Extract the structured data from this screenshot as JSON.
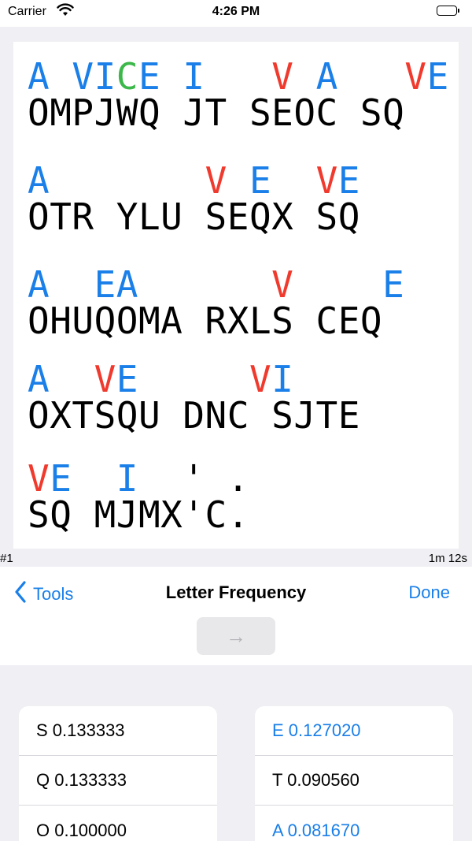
{
  "status_bar": {
    "carrier": "Carrier",
    "time": "4:26 PM"
  },
  "puzzle": {
    "lines": [
      {
        "hint": [
          {
            "text": "A",
            "color": "blue"
          },
          {
            "text": " ",
            "color": "blue"
          },
          {
            "text": "VI",
            "color": "blue"
          },
          {
            "text": "C",
            "color": "green"
          },
          {
            "text": "E",
            "color": "blue"
          },
          {
            "text": " ",
            "color": "blue"
          },
          {
            "text": "I",
            "color": "blue"
          },
          {
            "text": "   ",
            "color": "blue"
          },
          {
            "text": "V",
            "color": "red"
          },
          {
            "text": " ",
            "color": "blue"
          },
          {
            "text": "A",
            "color": "blue"
          },
          {
            "text": "   ",
            "color": "blue"
          },
          {
            "text": "V",
            "color": "red"
          },
          {
            "text": "E",
            "color": "blue"
          }
        ],
        "cipher": "OMPJWQ JT SEOC SQ"
      },
      {
        "hint": [
          {
            "text": "A",
            "color": "blue"
          },
          {
            "text": "       ",
            "color": "blue"
          },
          {
            "text": "V",
            "color": "red"
          },
          {
            "text": " ",
            "color": "blue"
          },
          {
            "text": "E",
            "color": "blue"
          },
          {
            "text": "  ",
            "color": "blue"
          },
          {
            "text": "V",
            "color": "red"
          },
          {
            "text": "E",
            "color": "blue"
          }
        ],
        "cipher": "OTR YLU SEQX SQ"
      },
      {
        "hint": [
          {
            "text": "A",
            "color": "blue"
          },
          {
            "text": "  ",
            "color": "blue"
          },
          {
            "text": "EA",
            "color": "blue"
          },
          {
            "text": "      ",
            "color": "blue"
          },
          {
            "text": "V",
            "color": "red"
          },
          {
            "text": "    ",
            "color": "blue"
          },
          {
            "text": "E",
            "color": "blue"
          }
        ],
        "cipher": "OHUQOMA RXLS CEQ"
      },
      {
        "hint": [
          {
            "text": "A",
            "color": "blue"
          },
          {
            "text": "  ",
            "color": "blue"
          },
          {
            "text": "V",
            "color": "red"
          },
          {
            "text": "E",
            "color": "blue"
          },
          {
            "text": "     ",
            "color": "blue"
          },
          {
            "text": "V",
            "color": "red"
          },
          {
            "text": "I",
            "color": "blue"
          }
        ],
        "cipher": "OXTSQU DNC SJTE"
      },
      {
        "hint": [
          {
            "text": "V",
            "color": "red"
          },
          {
            "text": "E",
            "color": "blue"
          },
          {
            "text": "  ",
            "color": "blue"
          },
          {
            "text": "I",
            "color": "blue"
          },
          {
            "text": "  ",
            "color": "blue"
          },
          {
            "text": "'",
            "color": "black"
          },
          {
            "text": " ",
            "color": "blue"
          },
          {
            "text": ".",
            "color": "black"
          }
        ],
        "cipher": "SQ MJMX'C."
      }
    ]
  },
  "meta": {
    "puzzle_number": "#1",
    "elapsed": "1m 12s"
  },
  "nav": {
    "back_label": "Tools",
    "title": "Letter Frequency",
    "done_label": "Done",
    "arrow_glyph": "→"
  },
  "frequency_left": [
    {
      "label": "S 0.133333",
      "color": "black"
    },
    {
      "label": "Q 0.133333",
      "color": "black"
    },
    {
      "label": "O 0.100000",
      "color": "black"
    }
  ],
  "frequency_right": [
    {
      "label": "E 0.127020",
      "color": "blue"
    },
    {
      "label": "T 0.090560",
      "color": "black"
    },
    {
      "label": "A 0.081670",
      "color": "blue"
    }
  ],
  "colors": {
    "blue": "#1a7fe8",
    "red": "#f03a2e",
    "green": "#3cb84a"
  }
}
